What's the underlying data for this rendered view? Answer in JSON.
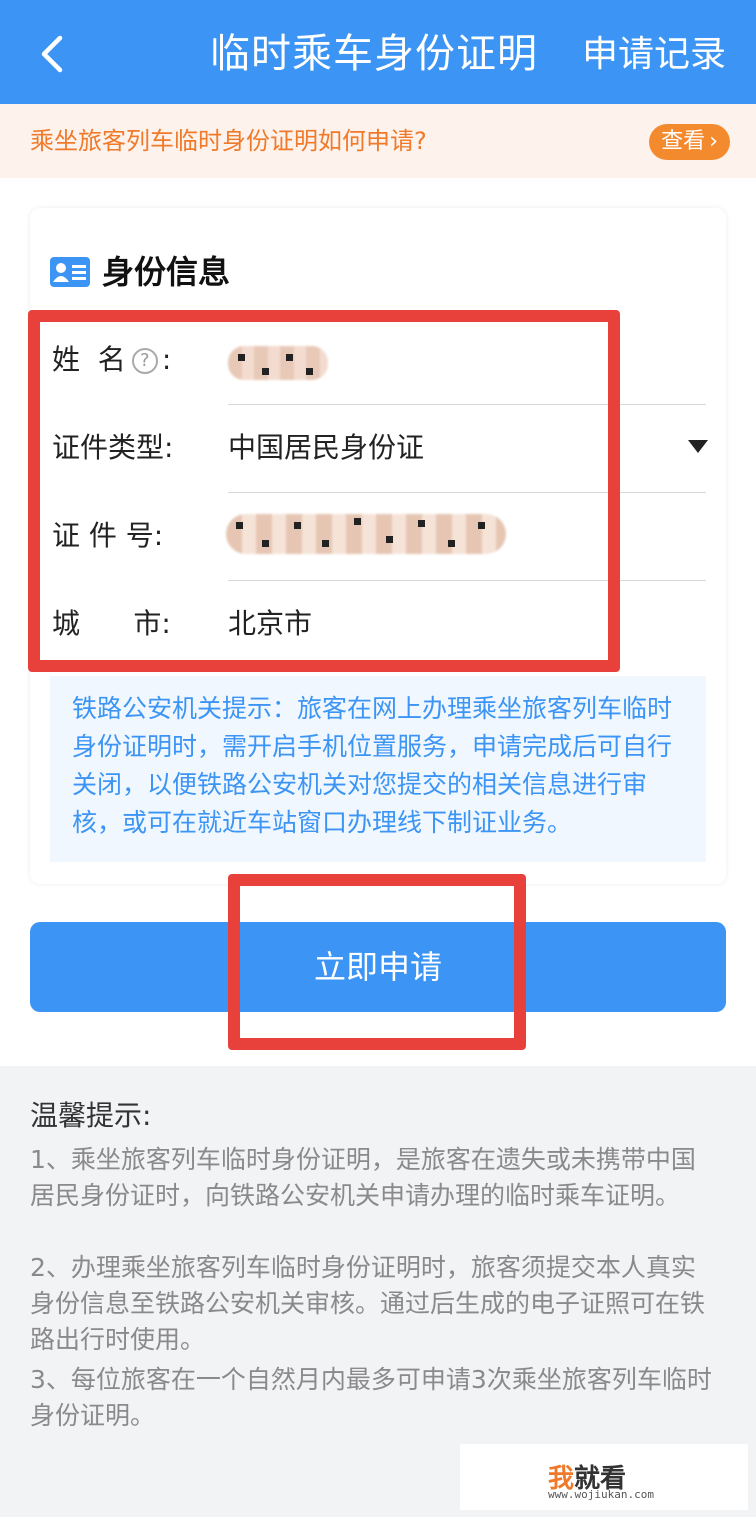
{
  "header": {
    "title": "临时乘车身份证明",
    "record_label": "申请记录"
  },
  "notice": {
    "text": "乘坐旅客列车临时身份证明如何申请?",
    "view_label": "查看",
    "view_arrow": "›"
  },
  "card": {
    "title": "身份信息",
    "name_label": "姓  名",
    "name_help": "?",
    "name_colon": ":",
    "doc_type_label": "证件类型:",
    "doc_type_value": "中国居民身份证",
    "doc_no_label": "证 件 号:",
    "city_label": "城      市:",
    "city_value": "北京市",
    "tip": "铁路公安机关提示：旅客在网上办理乘坐旅客列车临时身份证明时，需开启手机位置服务，申请完成后可自行关闭，以便铁路公安机关对您提交的相关信息进行审核，或可在就近车站窗口办理线下制证业务。"
  },
  "submit_label": "立即申请",
  "warm": {
    "title": "温馨提示:",
    "items": [
      "1、乘坐旅客列车临时身份证明，是旅客在遗失或未携带中国居民身份证时，向铁路公安机关申请办理的临时乘车证明。",
      "2、办理乘坐旅客列车临时身份证明时，旅客须提交本人真实身份信息至铁路公安机关审核。通过后生成的电子证照可在铁路出行时使用。",
      "3、每位旅客在一个自然月内最多可申请3次乘坐旅客列车临时身份证明。"
    ]
  },
  "watermark": {
    "logo_first": "我",
    "logo_rest": "就看",
    "url": "www.wojiukan.com"
  },
  "colors": {
    "header_blue": "#3c95f4",
    "notice_orange": "#f07a2a",
    "highlight_red": "#e8403a"
  }
}
